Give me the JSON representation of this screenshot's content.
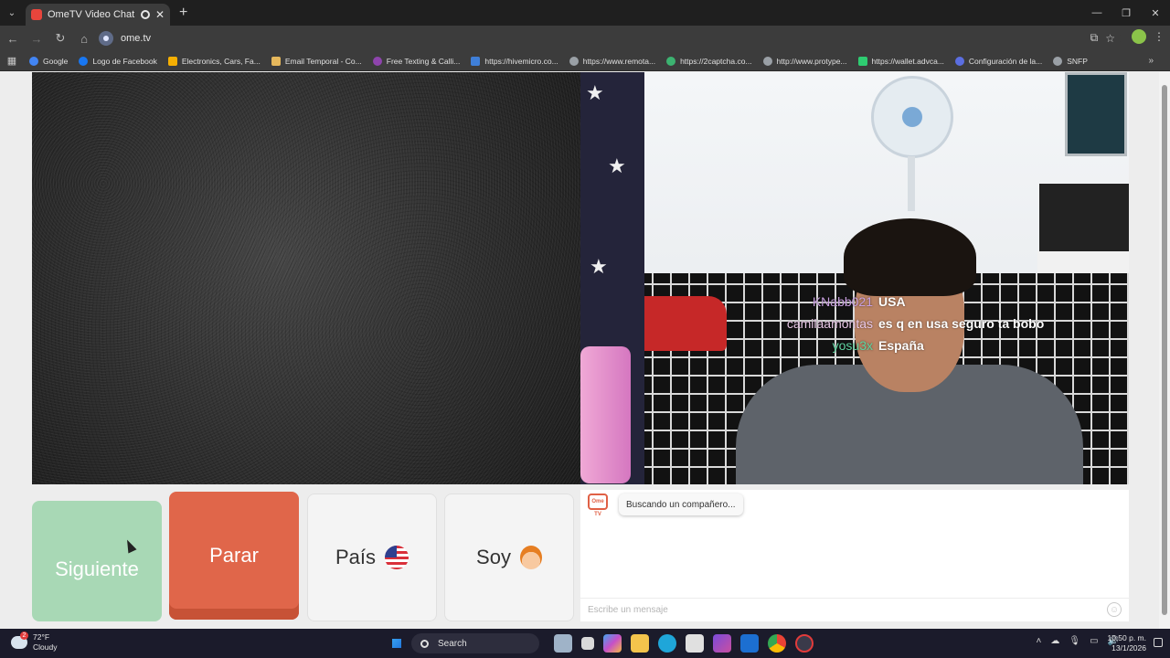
{
  "browser": {
    "tab_title": "OmeTV Video Chat — Ome",
    "url": "ome.tv",
    "bookmarks": [
      "Google",
      "Logo de Facebook",
      "Electronics, Cars, Fa...",
      "Email Temporal - Co...",
      "Free Texting & Calli...",
      "https://hivemicro.co...",
      "https://www.remota...",
      "https://2captcha.co...",
      "http://www.protype...",
      "https://wallet.advca...",
      "Configuración de la...",
      "SNFP"
    ]
  },
  "chat_overlay": [
    {
      "user": "KNabb021",
      "message": "USA",
      "color": "#c9a0e0"
    },
    {
      "user": "camilaamontas",
      "message": "es q en usa seguro ta bobo",
      "color": "#e8c7e6"
    },
    {
      "user": "yosu3x",
      "message": "España",
      "color": "#5fd4a0"
    }
  ],
  "controls": {
    "next_label": "Siguiente",
    "stop_label": "Parar",
    "country_label": "País",
    "gender_label": "Soy"
  },
  "chat_panel": {
    "bot_logo": "Ome TV",
    "status_message": "Buscando un compañero...",
    "input_placeholder": "Escribe un mensaje"
  },
  "taskbar": {
    "temperature": "72°F",
    "weather": "Cloudy",
    "search_label": "Search",
    "time": "10:50 p. m.",
    "date": "13/1/2026"
  },
  "colors": {
    "next_button": "#a8d8b5",
    "stop_button": "#e0664a",
    "accent": "#e06045"
  }
}
